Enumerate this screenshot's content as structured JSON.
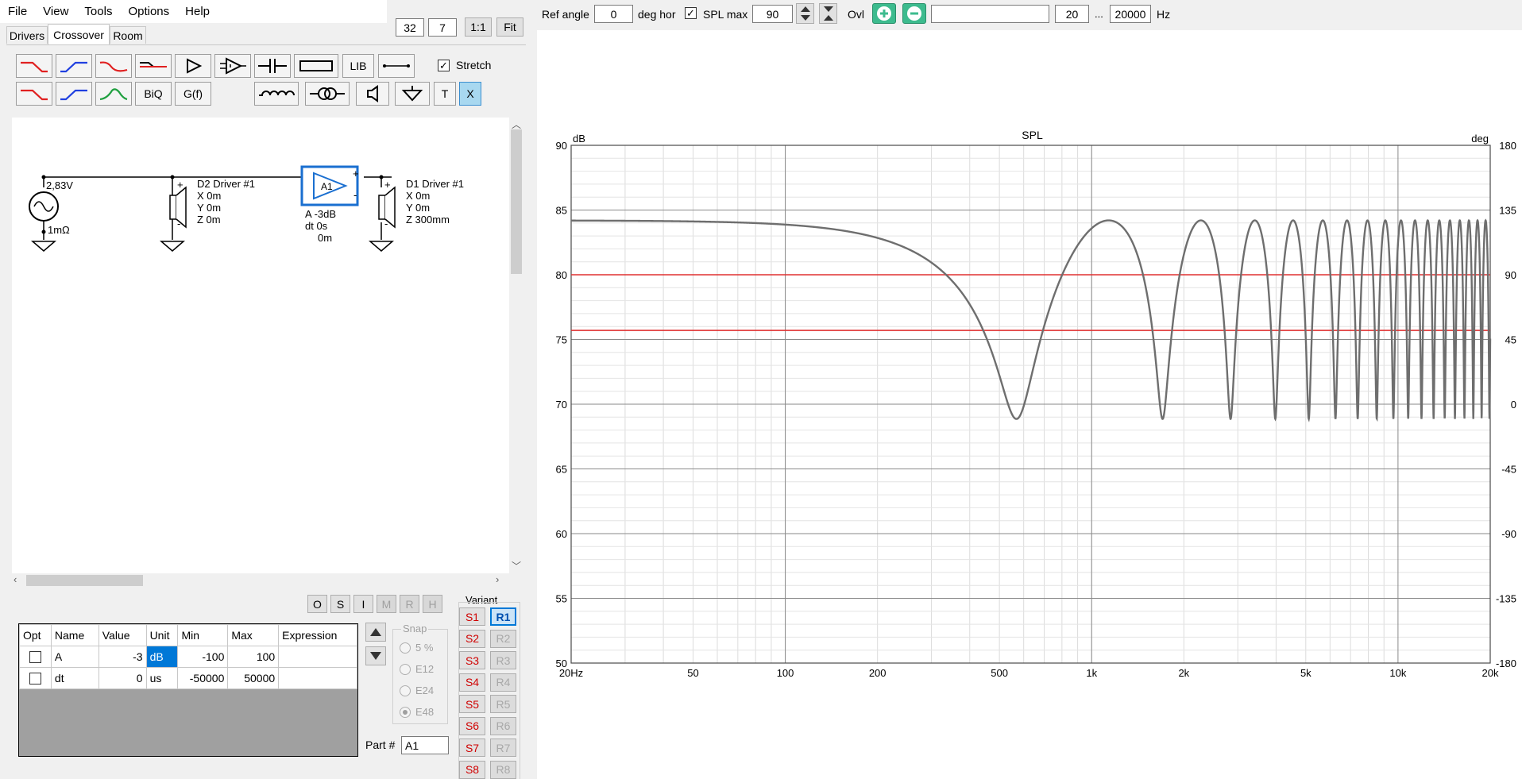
{
  "menu": [
    "File",
    "View",
    "Tools",
    "Options",
    "Help"
  ],
  "zoom": {
    "a": "32",
    "b": "7",
    "one_to_one": "1:1",
    "fit": "Fit"
  },
  "tabs": [
    "Drivers",
    "Crossover",
    "Room"
  ],
  "toolbar": {
    "lib": "LIB",
    "biq": "BiQ",
    "gf": "G(f)",
    "t": "T",
    "x": "X",
    "stretch": "Stretch"
  },
  "schematic": {
    "source_voltage": "2,83V",
    "source_res": "1mΩ",
    "d2": {
      "name": "D2 Driver #1",
      "x": "X 0m",
      "y": "Y 0m",
      "z": "Z 0m"
    },
    "amp": {
      "label": "A1",
      "gain": "A  -3dB",
      "dt": "dt 0s",
      "off": "0m"
    },
    "d1": {
      "name": "D1 Driver #1",
      "x": "X 0m",
      "y": "Y 0m",
      "z": "Z 300mm"
    }
  },
  "osimrh": [
    "O",
    "S",
    "I",
    "M",
    "R",
    "H"
  ],
  "table": {
    "headers": [
      "Opt",
      "Name",
      "Value",
      "Unit",
      "Min",
      "Max",
      "Expression"
    ],
    "rows": [
      {
        "name": "A",
        "value": "-3",
        "unit": "dB",
        "min": "-100",
        "max": "100",
        "expr": ""
      },
      {
        "name": "dt",
        "value": "0",
        "unit": "us",
        "min": "-50000",
        "max": "50000",
        "expr": ""
      }
    ]
  },
  "snap": {
    "title": "Snap",
    "options": [
      "5 %",
      "E12",
      "E24",
      "E48"
    ]
  },
  "part": {
    "label": "Part #",
    "value": "A1"
  },
  "variant": {
    "title": "Variant",
    "s": [
      "S1",
      "S2",
      "S3",
      "S4",
      "S5",
      "S6",
      "S7",
      "S8"
    ],
    "r": [
      "R1",
      "R2",
      "R3",
      "R4",
      "R5",
      "R6",
      "R7",
      "R8"
    ]
  },
  "graph_toolbar": {
    "ref_angle_label": "Ref angle",
    "ref_angle": "0",
    "deg_hor": "deg hor",
    "spl_max_label": "SPL max",
    "spl_max": "90",
    "ovl": "Ovl",
    "fmin": "20",
    "dots": "...",
    "fmax": "20000",
    "hz": "Hz"
  },
  "chart_data": {
    "type": "line",
    "title": "SPL",
    "ylabel": "dB",
    "y2label": "deg",
    "xscale": "log",
    "xlim": [
      20,
      20000
    ],
    "ylim": [
      50,
      90
    ],
    "y2lim": [
      -180,
      180
    ],
    "x_ticks": [
      "20Hz",
      "50",
      "100",
      "200",
      "500",
      "1k",
      "2k",
      "5k",
      "10k",
      "20k"
    ],
    "x_tick_values": [
      20,
      50,
      100,
      200,
      500,
      1000,
      2000,
      5000,
      10000,
      20000
    ],
    "y_ticks": [
      90,
      85,
      80,
      75,
      70,
      65,
      60,
      55,
      50
    ],
    "y2_ticks": [
      180,
      135,
      90,
      45,
      0,
      -45,
      -90,
      -135,
      -180
    ],
    "reference_lines_db": [
      80,
      75.7
    ],
    "series": [
      {
        "color": "#6e6e6e",
        "model": "comb",
        "delay_ms": 0.88,
        "a_gain": 1.0,
        "b_gain": 0.708,
        "peak_db": 84.2,
        "points": [
          [
            20,
            84.1
          ],
          [
            100,
            83.8
          ],
          [
            200,
            82.9
          ],
          [
            300,
            81.3
          ],
          [
            400,
            78.8
          ],
          [
            500,
            74.8
          ],
          [
            568,
            71.6
          ],
          [
            700,
            75.7
          ],
          [
            800,
            79.6
          ],
          [
            1000,
            83.6
          ],
          [
            1136,
            84.2
          ],
          [
            1500,
            81.4
          ],
          [
            1704,
            71.6
          ],
          [
            2272,
            84.2
          ],
          [
            2840,
            71.6
          ],
          [
            3409,
            84.2
          ]
        ]
      }
    ]
  },
  "colors": {
    "ref_line": "#e03030",
    "accent": "#0066cc",
    "spl_curve": "#6e6e6e",
    "variant_red": "#d00000"
  }
}
